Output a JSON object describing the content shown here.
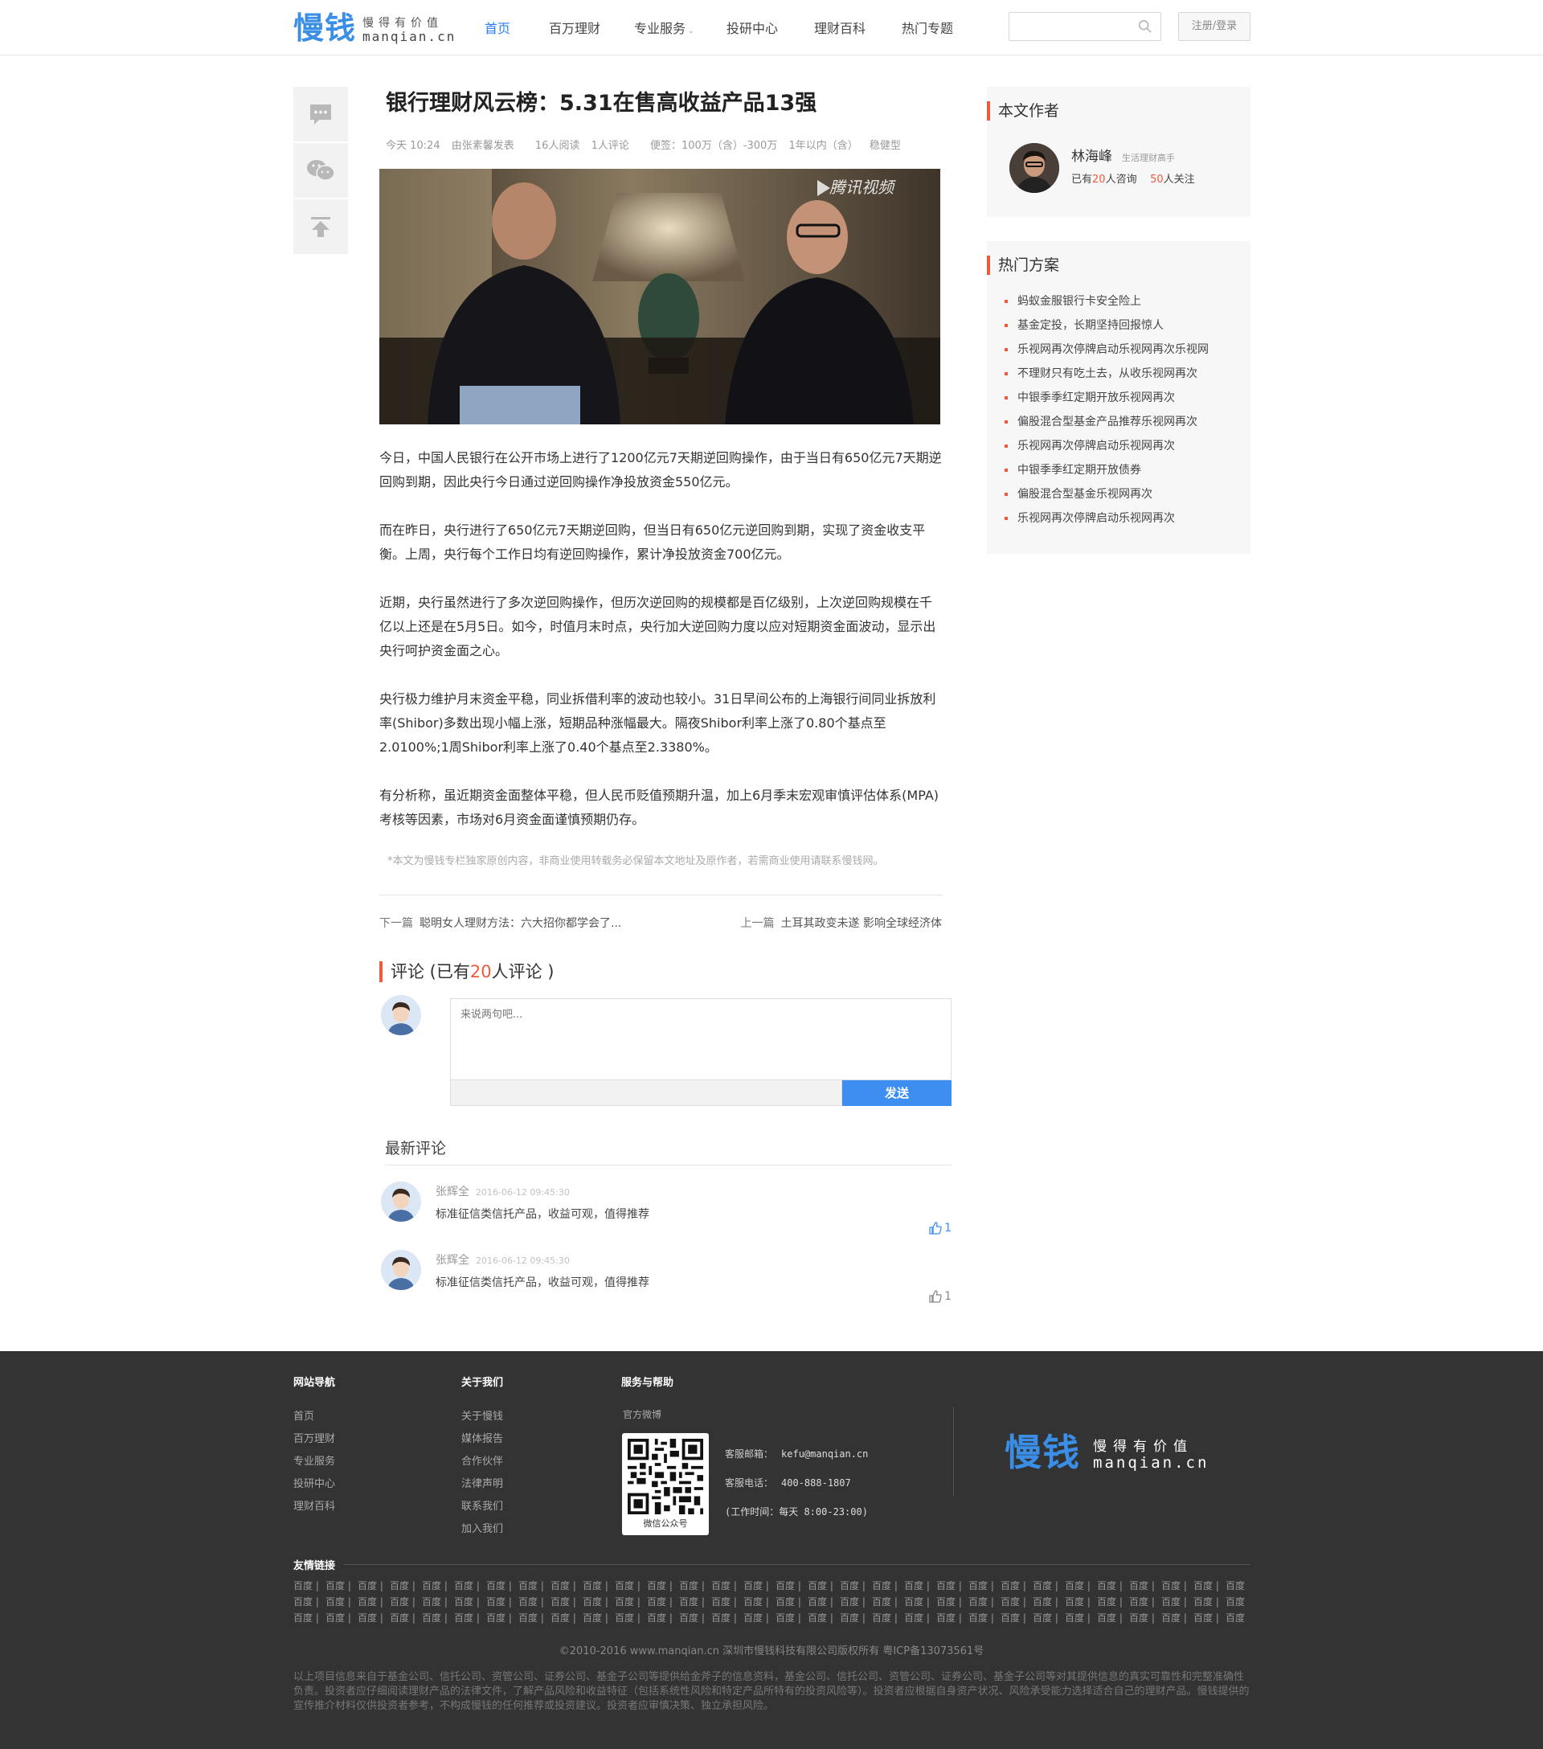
{
  "header": {
    "logo_mark": "慢钱",
    "logo_slogan": "慢得有价值",
    "logo_domain": "manqian.cn",
    "nav": [
      {
        "label": "首页",
        "active": true
      },
      {
        "label": "百万理财"
      },
      {
        "label": "专业服务",
        "dropdown": true
      },
      {
        "label": "投研中心"
      },
      {
        "label": "理财百科"
      },
      {
        "label": "热门专题"
      }
    ],
    "search_placeholder": "",
    "login_label": "注册/登录",
    "accent_color": "#2b7ff2"
  },
  "share": [
    "comment-icon",
    "wechat-icon",
    "back-to-top-icon"
  ],
  "article": {
    "title": "银行理财风云榜：5.31在售高收益产品13强",
    "meta": {
      "time": "今天 10:24",
      "author": "由张素馨发表",
      "reads": "16人阅读",
      "comments": "1人评论",
      "tags": "便签：100万（含）-300万",
      "term": "1年以内（含）",
      "risk": "稳健型"
    },
    "image_watermark": "腾讯视频",
    "paragraphs": [
      "今日，中国人民银行在公开市场上进行了1200亿元7天期逆回购操作，由于当日有650亿元7天期逆回购到期，因此央行今日通过逆回购操作净投放资金550亿元。",
      "而在昨日，央行进行了650亿元7天期逆回购，但当日有650亿元逆回购到期，实现了资金收支平衡。上周，央行每个工作日均有逆回购操作，累计净投放资金700亿元。",
      "近期，央行虽然进行了多次逆回购操作，但历次逆回购的规模都是百亿级别，上次逆回购规模在千亿以上还是在5月5日。如今，时值月末时点，央行加大逆回购力度以应对短期资金面波动，显示出央行呵护资金面之心。",
      "央行极力维护月末资金平稳，同业拆借利率的波动也较小。31日早间公布的上海银行间同业拆放利率(Shibor)多数出现小幅上涨，短期品种涨幅最大。隔夜Shibor利率上涨了0.80个基点至2.0100%;1周Shibor利率上涨了0.40个基点至2.3380%。",
      "有分析称，虽近期资金面整体平稳，但人民币贬值预期升温，加上6月季末宏观审慎评估体系(MPA)考核等因素，市场对6月资金面谨慎预期仍存。"
    ],
    "disclaimer": "*本文为慢钱专栏独家原创内容，非商业使用转载务必保留本文地址及原作者，若需商业使用请联系慢钱网。",
    "prev_label": "下一篇",
    "prev_title": "聪明女人理财方法：六大招你都学会了...",
    "next_label": "上一篇",
    "next_title": "土耳其政变未遂 影响全球经济体"
  },
  "comments": {
    "head_prefix": "评论 (已有",
    "head_count": "20",
    "head_suffix": "人评论 )",
    "placeholder": "来说两句吧...",
    "send_label": "发送",
    "latest_title": "最新评论",
    "items": [
      {
        "user": "张辉全",
        "time": "2016-06-12 09:45:30",
        "text": "标准征信类信托产品，收益可观，值得推荐",
        "likes": "1",
        "liked": true
      },
      {
        "user": "张辉全",
        "time": "2016-06-12 09:45:30",
        "text": "标准征信类信托产品，收益可观，值得推荐",
        "likes": "1",
        "liked": false
      }
    ]
  },
  "author_panel": {
    "title": "本文作者",
    "name": "林海峰",
    "tag": "生活理财高手",
    "stat_prefix": "已有",
    "consults": "20",
    "stat_mid": "人咨询",
    "follows": "50",
    "stat_suffix": "人关注"
  },
  "hot_panel": {
    "title": "热门方案",
    "items": [
      "蚂蚁金服银行卡安全险上",
      "基金定投，长期坚持回报惊人",
      "乐视网再次停牌启动乐视网再次乐视网",
      "不理财只有吃土去，从收乐视网再次",
      "中银季季红定期开放乐视网再次",
      "偏股混合型基金产品推荐乐视网再次",
      "乐视网再次停牌启动乐视网再次",
      "中银季季红定期开放债券",
      "偏股混合型基金乐视网再次",
      "乐视网再次停牌启动乐视网再次"
    ]
  },
  "footer": {
    "nav_title": "网站导航",
    "nav_links": [
      "首页",
      "百万理财",
      "专业服务",
      "投研中心",
      "理财百科"
    ],
    "about_title": "关于我们",
    "about_links": [
      "关于慢钱",
      "媒体报告",
      "合作伙伴",
      "法律声明",
      "联系我们",
      "加入我们"
    ],
    "service_title": "服务与帮助",
    "weibo_label": "官方微博",
    "qr_caption": "微信公众号",
    "email_label": "客服邮箱：",
    "email": "kefu@manqian.cn",
    "phone_label": "客服电话：",
    "phone": "400-888-1807",
    "hours": "(工作时间：每天 8:00-23:00)",
    "friend_title": "友情链接",
    "friend_link": "百度",
    "copyright": "©2010-2016 www.manqian.cn 深圳市慢钱科技有限公司版权所有   粤ICP备13073561号",
    "disclaimer": "以上项目信息来自于基金公司、信托公司、资管公司、证券公司、基金子公司等提供给金斧子的信息资料，基金公司、信托公司、资管公司、证券公司、基金子公司等对其提供信息的真实可靠性和完整准确性负责。投资者应仔细阅读理财产品的法律文件，了解产品风险和收益特征（包括系统性风险和特定产品所特有的投资风险等）。投资者应根据自身资产状况、风险承受能力选择适合自己的理财产品。慢钱提供的宣传推介材料仅供投资者参考，不构成慢钱的任何推荐或投资建议。投资者应审慎决策、独立承担风险。"
  }
}
